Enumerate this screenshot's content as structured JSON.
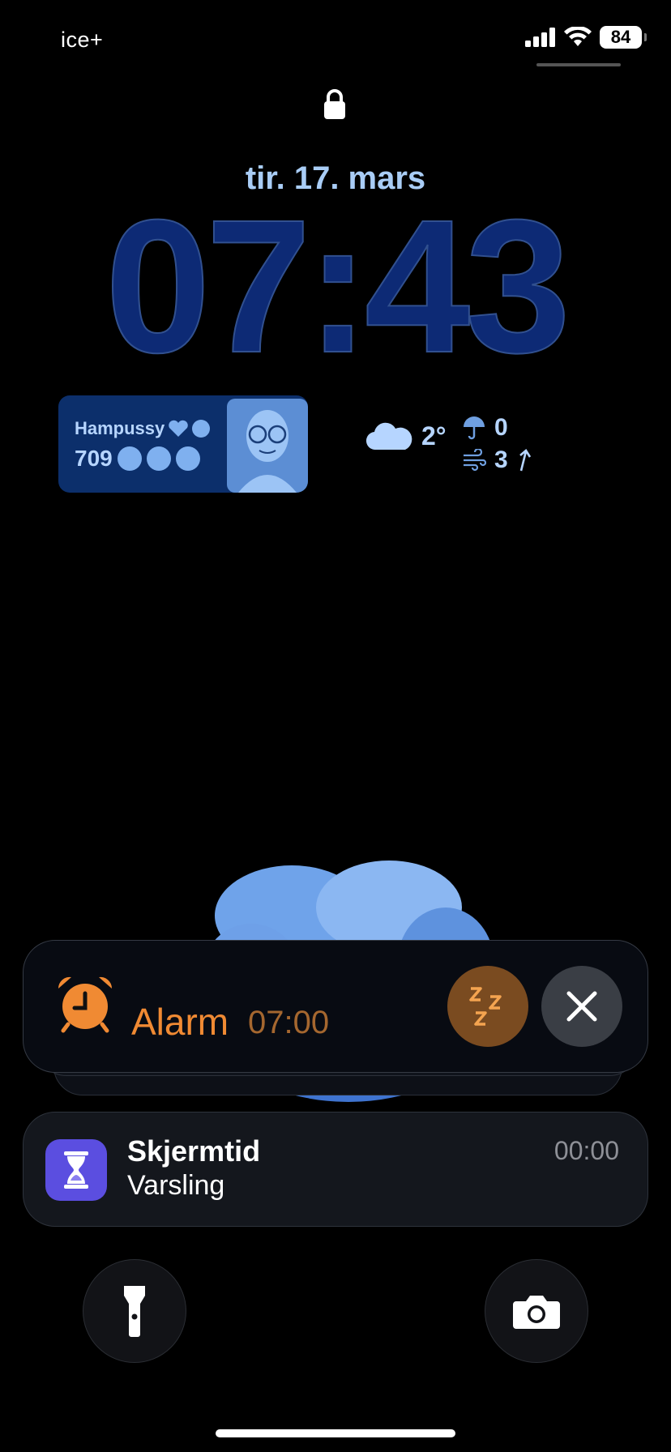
{
  "status_bar": {
    "carrier": "ice+",
    "battery": "84",
    "icons": [
      "cellular-signal-icon",
      "wifi-icon",
      "battery-icon"
    ]
  },
  "lock_screen": {
    "date": "tir. 17. mars",
    "time": "07:43",
    "lock_icon": "lock-icon"
  },
  "widgets": {
    "contact": {
      "name": "Hampussy",
      "count": "709"
    },
    "weather": {
      "temperature": "2°",
      "precipitation": "0",
      "wind": "3",
      "icons": [
        "cloud-icon",
        "umbrella-icon",
        "wind-icon",
        "wind-direction-arrow-icon"
      ]
    }
  },
  "notifications": {
    "alarm": {
      "label": "Alarm",
      "time": "07:00",
      "snooze_icon": "snooze-icon",
      "close_icon": "close-icon"
    },
    "screen_time": {
      "app": "Skjermtid",
      "message": "Varsling",
      "time": "00:00"
    }
  },
  "quick_actions": [
    "flashlight-icon",
    "camera-icon"
  ],
  "colors": {
    "date_text": "#a9cdf6",
    "clock": "#0d2a75",
    "widget_bg": "#0c2f6b",
    "alarm_orange": "#f08a33",
    "snooze_bg": "#7a4b20",
    "screen_time_icon_bg": "#5b4ee0"
  }
}
